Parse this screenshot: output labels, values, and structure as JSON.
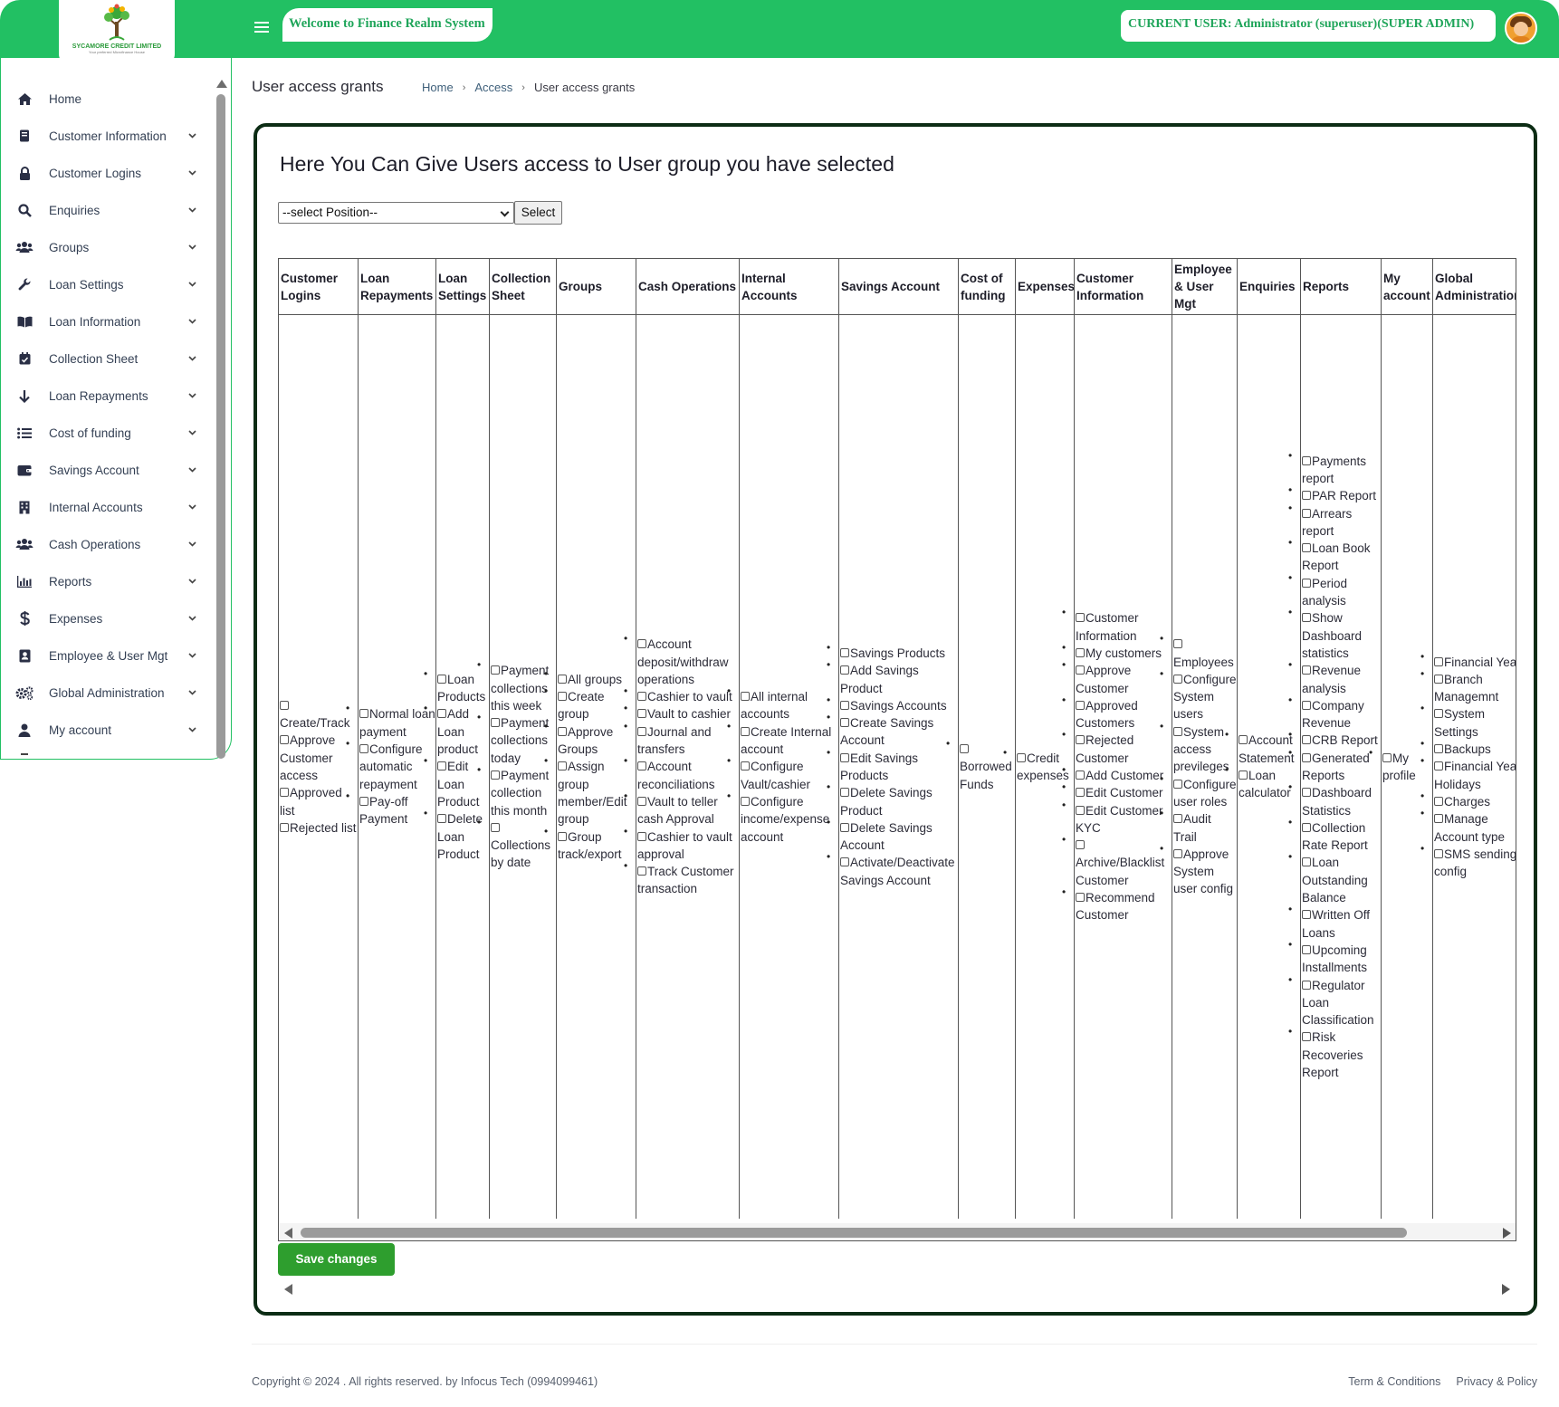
{
  "brand": {
    "logo_name": "SYCAMORE CREDIT LIMITED",
    "logo_tagline": "Your preferred Microfinance House"
  },
  "topbar": {
    "welcome": "Welcome to Finance Realm System",
    "current_user": "CURRENT USER: Administrator (superuser)(SUPER ADMIN)",
    "accent": "#22c063"
  },
  "sidebar": {
    "items": [
      {
        "label": "Home",
        "icon": "home-icon"
      },
      {
        "label": "Customer Information",
        "icon": "document-icon"
      },
      {
        "label": "Customer Logins",
        "icon": "lock-icon"
      },
      {
        "label": "Enquiries",
        "icon": "search-icon"
      },
      {
        "label": "Groups",
        "icon": "users-icon"
      },
      {
        "label": "Loan Settings",
        "icon": "wrench-icon"
      },
      {
        "label": "Loan Information",
        "icon": "book-icon"
      },
      {
        "label": "Collection Sheet",
        "icon": "calendar-icon"
      },
      {
        "label": "Loan Repayments",
        "icon": "arrow-down-icon"
      },
      {
        "label": "Cost of funding",
        "icon": "list-icon"
      },
      {
        "label": "Savings Account",
        "icon": "wallet-icon"
      },
      {
        "label": "Internal Accounts",
        "icon": "building-icon"
      },
      {
        "label": "Cash Operations",
        "icon": "users-icon"
      },
      {
        "label": "Reports",
        "icon": "bar-chart-icon"
      },
      {
        "label": "Expenses",
        "icon": "dollar-icon"
      },
      {
        "label": "Employee & User Mgt",
        "icon": "id-card-icon"
      },
      {
        "label": "Global Administration",
        "icon": "gears-icon"
      },
      {
        "label": "My account",
        "icon": "user-icon"
      }
    ]
  },
  "header": {
    "title": "User access grants",
    "breadcrumb": [
      "Home",
      "Access",
      "User access grants"
    ]
  },
  "card": {
    "heading": "Here You Can Give Users access to User group you have selected",
    "select_value": "--select Position--",
    "select_button": "Select",
    "save_button": "Save changes"
  },
  "permissions": {
    "columns": [
      {
        "header": "Customer Logins",
        "items": [
          "Create/Track",
          "Approve Customer access",
          "Approved list",
          "Rejected list"
        ]
      },
      {
        "header": "Loan Repayments",
        "items": [
          "Normal loan payment",
          "Configure automatic repayment",
          "Pay-off Payment"
        ]
      },
      {
        "header": "Loan Settings",
        "items": [
          "Loan Products",
          "Add Loan product",
          "Edit Loan Product",
          "Delete Loan Product"
        ]
      },
      {
        "header": "Collection Sheet",
        "items": [
          "Payment collections this week",
          "Payment collections today",
          "Payment collection this month",
          "Collections by date"
        ]
      },
      {
        "header": "Groups",
        "items": [
          "All groups",
          "Create group",
          "Approve Groups",
          "Assign group member/Edit group",
          "Group track/export"
        ]
      },
      {
        "header": "Cash Operations",
        "items": [
          "Account deposit/withdraw operations",
          "Cashier to vault",
          "Vault to cashier",
          "Journal and transfers",
          "Account reconciliations",
          "Vault to teller cash Approval",
          "Cashier to vault approval",
          "Track Customer transaction"
        ]
      },
      {
        "header": "Internal Accounts",
        "items": [
          "All internal accounts",
          "Create Internal account",
          "Configure Vault/cashier",
          "Configure income/expense account"
        ]
      },
      {
        "header": "Savings Account",
        "items": [
          "Savings Products",
          "Add Savings Product",
          "Savings Accounts",
          "Create Savings Account",
          "Edit Savings Products",
          "Delete Savings Product",
          "Delete Savings Account",
          "Activate/Deactivate Savings Account"
        ]
      },
      {
        "header": "Cost of funding",
        "items": [
          "Borrowed Funds"
        ]
      },
      {
        "header": "Expenses",
        "items": [
          "Credit expenses"
        ]
      },
      {
        "header": "Customer Information",
        "items": [
          "Customer Information",
          "My customers",
          "Approve Customer",
          "Approved Customers",
          "Rejected Customer",
          "Add Customer",
          "Edit Customer",
          "Edit Customer KYC",
          "Archive/Blacklist Customer",
          "Recommend Customer"
        ]
      },
      {
        "header": "Employee & User Mgt",
        "items": [
          "Employees",
          "Configure System users",
          "System access previleges",
          "Configure user roles",
          "Audit Trail",
          "Approve System user config"
        ]
      },
      {
        "header": "Enquiries",
        "items": [
          "Account Statement",
          "Loan calculator"
        ]
      },
      {
        "header": "Reports",
        "items": [
          "Payments report",
          "PAR Report",
          "Arrears report",
          "Loan Book Report",
          "Period analysis",
          "Show Dashboard statistics",
          "Revenue analysis",
          "Company Revenue",
          "CRB Report",
          "Generated Reports",
          "Dashboard Statistics",
          "Collection Rate Report",
          "Loan Outstanding Balance",
          "Written Off Loans",
          "Upcoming Installments",
          "Regulator Loan Classification",
          "Risk Recoveries Report"
        ]
      },
      {
        "header": "My account",
        "items": [
          "My profile"
        ]
      },
      {
        "header": "Global Administration",
        "items": [
          "Financial Year",
          "Branch Managemnt",
          "System Settings",
          "Backups",
          "Financial Year Holidays",
          "Charges",
          "Manage Account type",
          "SMS sending config"
        ]
      }
    ]
  },
  "footer": {
    "copyright": "Copyright © 2024 . All rights reserved. by Infocus Tech (0994099461)",
    "links": [
      "Term & Conditions",
      "Privacy & Policy"
    ]
  }
}
